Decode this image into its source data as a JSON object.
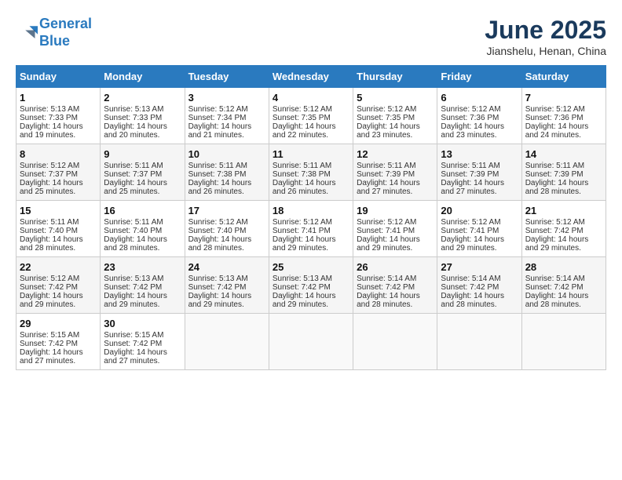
{
  "header": {
    "logo_line1": "General",
    "logo_line2": "Blue",
    "month_title": "June 2025",
    "location": "Jianshelu, Henan, China"
  },
  "weekdays": [
    "Sunday",
    "Monday",
    "Tuesday",
    "Wednesday",
    "Thursday",
    "Friday",
    "Saturday"
  ],
  "weeks": [
    [
      {
        "day": 1,
        "sunrise": "5:13 AM",
        "sunset": "7:33 PM",
        "daylight": "14 hours and 19 minutes."
      },
      {
        "day": 2,
        "sunrise": "5:13 AM",
        "sunset": "7:33 PM",
        "daylight": "14 hours and 20 minutes."
      },
      {
        "day": 3,
        "sunrise": "5:12 AM",
        "sunset": "7:34 PM",
        "daylight": "14 hours and 21 minutes."
      },
      {
        "day": 4,
        "sunrise": "5:12 AM",
        "sunset": "7:35 PM",
        "daylight": "14 hours and 22 minutes."
      },
      {
        "day": 5,
        "sunrise": "5:12 AM",
        "sunset": "7:35 PM",
        "daylight": "14 hours and 23 minutes."
      },
      {
        "day": 6,
        "sunrise": "5:12 AM",
        "sunset": "7:36 PM",
        "daylight": "14 hours and 23 minutes."
      },
      {
        "day": 7,
        "sunrise": "5:12 AM",
        "sunset": "7:36 PM",
        "daylight": "14 hours and 24 minutes."
      }
    ],
    [
      {
        "day": 8,
        "sunrise": "5:12 AM",
        "sunset": "7:37 PM",
        "daylight": "14 hours and 25 minutes."
      },
      {
        "day": 9,
        "sunrise": "5:11 AM",
        "sunset": "7:37 PM",
        "daylight": "14 hours and 25 minutes."
      },
      {
        "day": 10,
        "sunrise": "5:11 AM",
        "sunset": "7:38 PM",
        "daylight": "14 hours and 26 minutes."
      },
      {
        "day": 11,
        "sunrise": "5:11 AM",
        "sunset": "7:38 PM",
        "daylight": "14 hours and 26 minutes."
      },
      {
        "day": 12,
        "sunrise": "5:11 AM",
        "sunset": "7:39 PM",
        "daylight": "14 hours and 27 minutes."
      },
      {
        "day": 13,
        "sunrise": "5:11 AM",
        "sunset": "7:39 PM",
        "daylight": "14 hours and 27 minutes."
      },
      {
        "day": 14,
        "sunrise": "5:11 AM",
        "sunset": "7:39 PM",
        "daylight": "14 hours and 28 minutes."
      }
    ],
    [
      {
        "day": 15,
        "sunrise": "5:11 AM",
        "sunset": "7:40 PM",
        "daylight": "14 hours and 28 minutes."
      },
      {
        "day": 16,
        "sunrise": "5:11 AM",
        "sunset": "7:40 PM",
        "daylight": "14 hours and 28 minutes."
      },
      {
        "day": 17,
        "sunrise": "5:12 AM",
        "sunset": "7:40 PM",
        "daylight": "14 hours and 28 minutes."
      },
      {
        "day": 18,
        "sunrise": "5:12 AM",
        "sunset": "7:41 PM",
        "daylight": "14 hours and 29 minutes."
      },
      {
        "day": 19,
        "sunrise": "5:12 AM",
        "sunset": "7:41 PM",
        "daylight": "14 hours and 29 minutes."
      },
      {
        "day": 20,
        "sunrise": "5:12 AM",
        "sunset": "7:41 PM",
        "daylight": "14 hours and 29 minutes."
      },
      {
        "day": 21,
        "sunrise": "5:12 AM",
        "sunset": "7:42 PM",
        "daylight": "14 hours and 29 minutes."
      }
    ],
    [
      {
        "day": 22,
        "sunrise": "5:12 AM",
        "sunset": "7:42 PM",
        "daylight": "14 hours and 29 minutes."
      },
      {
        "day": 23,
        "sunrise": "5:13 AM",
        "sunset": "7:42 PM",
        "daylight": "14 hours and 29 minutes."
      },
      {
        "day": 24,
        "sunrise": "5:13 AM",
        "sunset": "7:42 PM",
        "daylight": "14 hours and 29 minutes."
      },
      {
        "day": 25,
        "sunrise": "5:13 AM",
        "sunset": "7:42 PM",
        "daylight": "14 hours and 29 minutes."
      },
      {
        "day": 26,
        "sunrise": "5:14 AM",
        "sunset": "7:42 PM",
        "daylight": "14 hours and 28 minutes."
      },
      {
        "day": 27,
        "sunrise": "5:14 AM",
        "sunset": "7:42 PM",
        "daylight": "14 hours and 28 minutes."
      },
      {
        "day": 28,
        "sunrise": "5:14 AM",
        "sunset": "7:42 PM",
        "daylight": "14 hours and 28 minutes."
      }
    ],
    [
      {
        "day": 29,
        "sunrise": "5:15 AM",
        "sunset": "7:42 PM",
        "daylight": "14 hours and 27 minutes."
      },
      {
        "day": 30,
        "sunrise": "5:15 AM",
        "sunset": "7:42 PM",
        "daylight": "14 hours and 27 minutes."
      },
      null,
      null,
      null,
      null,
      null
    ]
  ]
}
